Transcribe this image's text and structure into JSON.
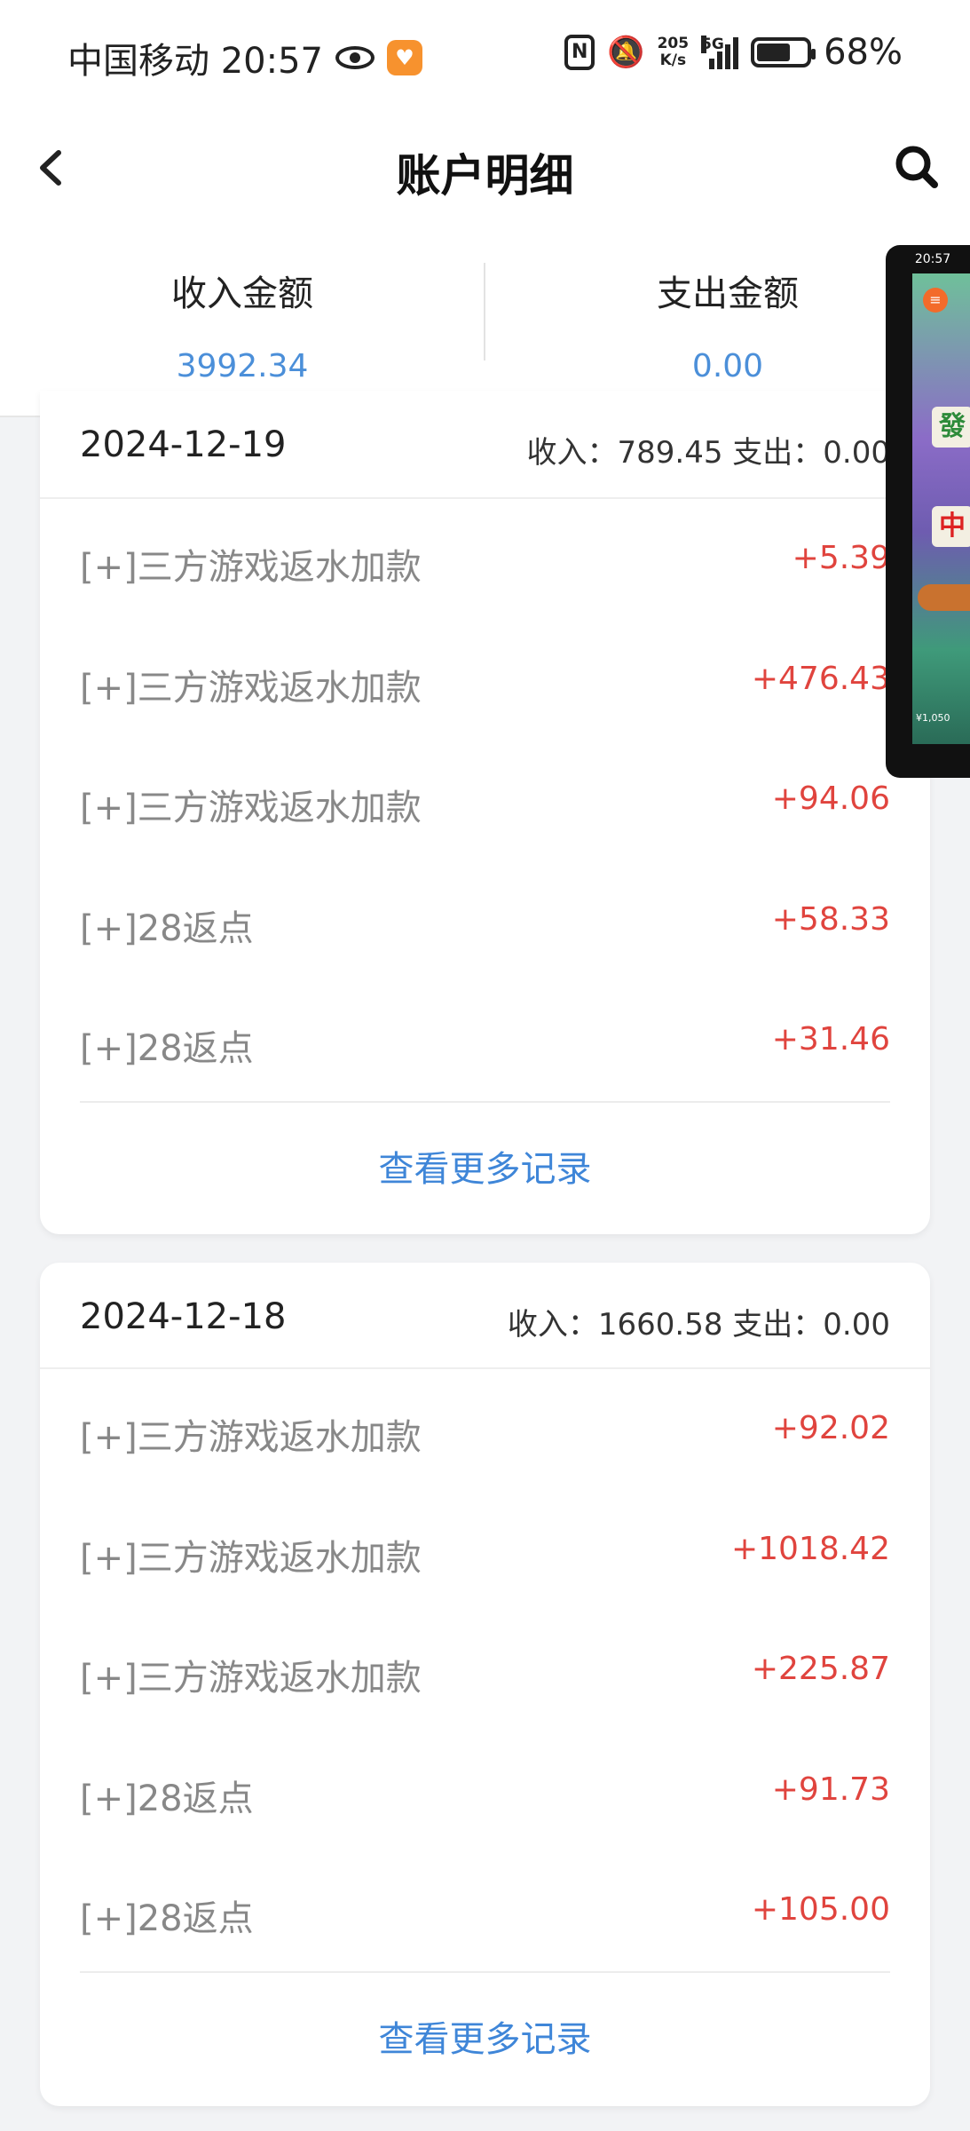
{
  "status_bar": {
    "carrier_time": "中国移动 20:57",
    "net_speed_value": "205",
    "net_speed_unit": "K/s",
    "network": "5G",
    "battery": "68%",
    "battery_level": 0.68
  },
  "nav": {
    "title": "账户明细",
    "back_icon": "chevron-left-icon",
    "search_icon": "search-icon"
  },
  "summary": {
    "income_label": "收入金额",
    "income_value": "3992.34",
    "expense_label": "支出金额",
    "expense_value": "0.00",
    "accent_color": "#4b8fd9"
  },
  "groups": [
    {
      "date": "2024-12-19",
      "stats": "收入：789.45 支出：0.00",
      "items": [
        {
          "label": "[+]三方游戏返水加款",
          "amount": "+5.39"
        },
        {
          "label": "[+]三方游戏返水加款",
          "amount": "+476.43"
        },
        {
          "label": "[+]三方游戏返水加款",
          "amount": "+94.06"
        },
        {
          "label": "[+]28返点",
          "amount": "+58.33"
        },
        {
          "label": "[+]28返点",
          "amount": "+31.46"
        }
      ],
      "more_label": "查看更多记录"
    },
    {
      "date": "2024-12-18",
      "stats": "收入：1660.58 支出：0.00",
      "items": [
        {
          "label": "[+]三方游戏返水加款",
          "amount": "+92.02"
        },
        {
          "label": "[+]三方游戏返水加款",
          "amount": "+1018.42"
        },
        {
          "label": "[+]三方游戏返水加款",
          "amount": "+225.87"
        },
        {
          "label": "[+]28返点",
          "amount": "+91.73"
        },
        {
          "label": "[+]28返点",
          "amount": "+105.00"
        }
      ],
      "more_label": "查看更多记录"
    }
  ],
  "floating_window": {
    "time": "20:57",
    "tiles": [
      "發",
      "中"
    ],
    "price": "¥1,050"
  },
  "colors": {
    "amount_positive": "#e0443e",
    "link": "#3f86d8",
    "background": "#f2f3f5"
  }
}
